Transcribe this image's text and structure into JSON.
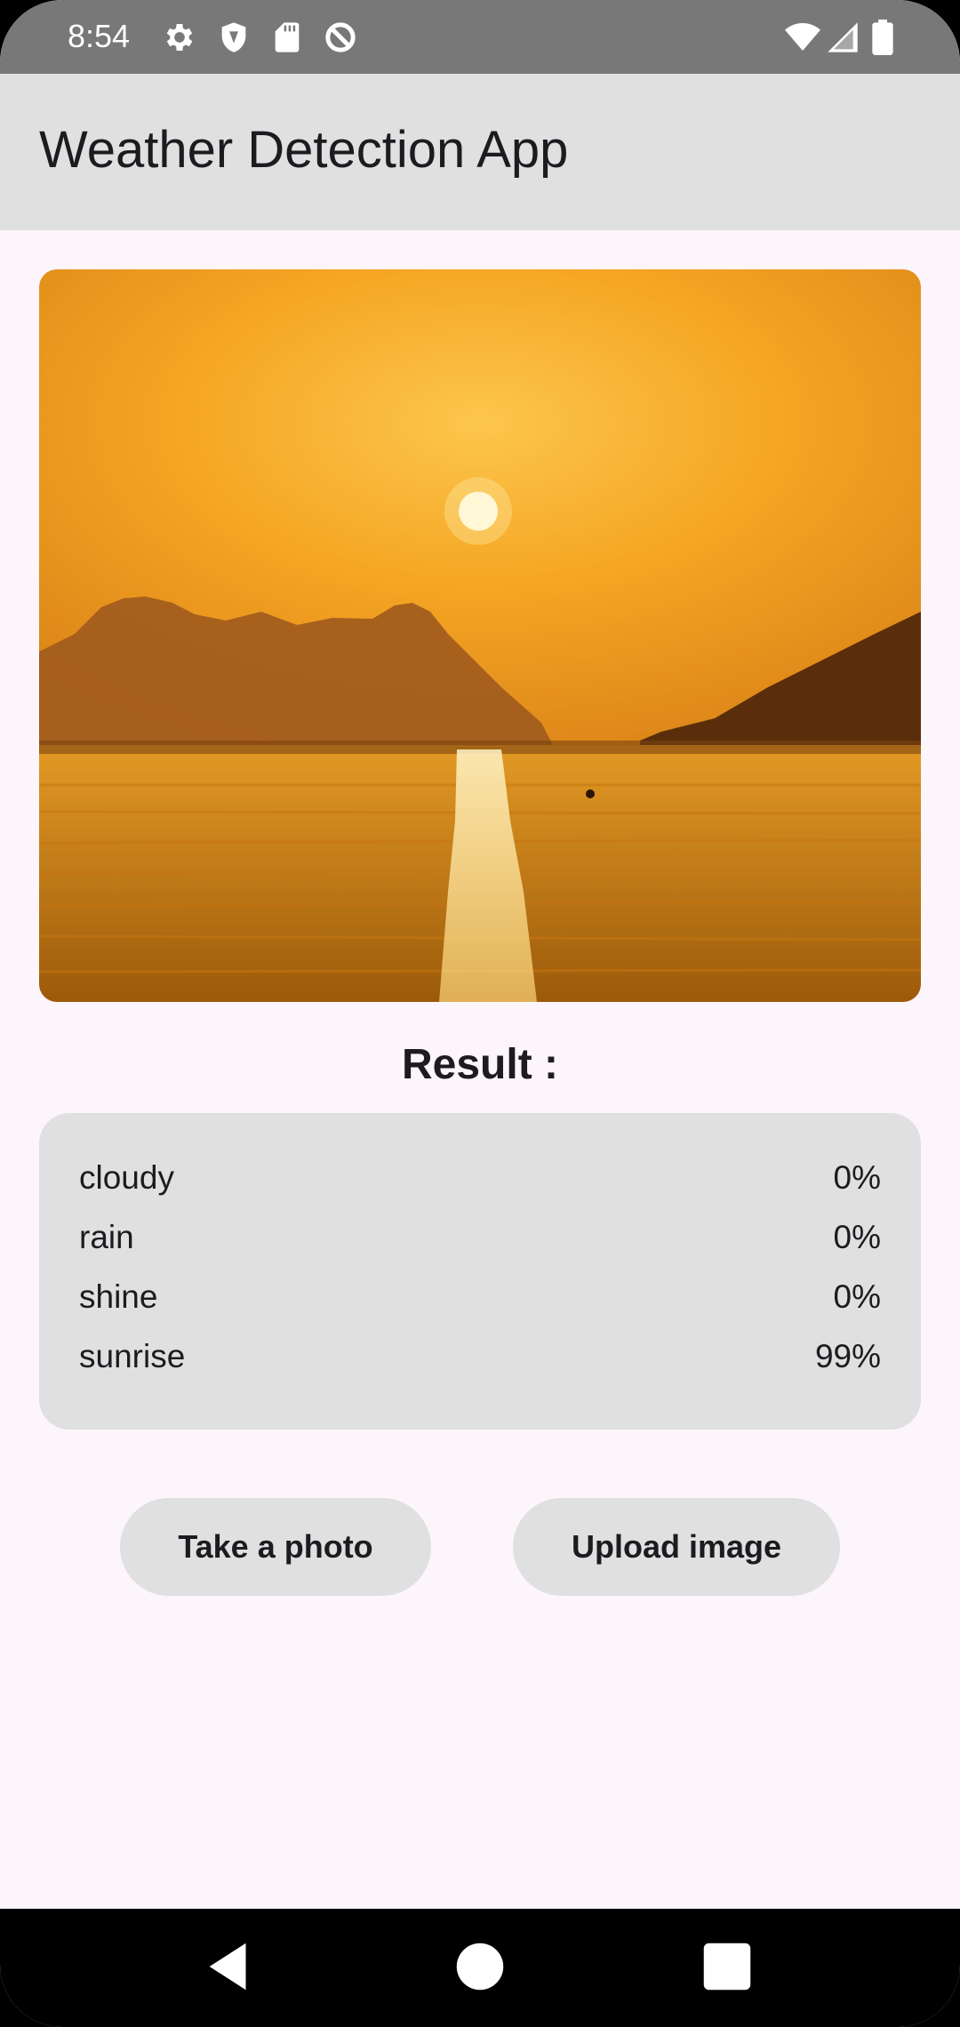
{
  "status_bar": {
    "time": "8:54",
    "left_icons": [
      "gear-icon",
      "shield-icon",
      "sd-card-icon",
      "data-saver-icon"
    ],
    "right_icons": [
      "wifi-icon",
      "cellular-signal-icon",
      "battery-icon"
    ]
  },
  "app_bar": {
    "title": "Weather Detection App"
  },
  "image": {
    "description_icon": "sunset-photo"
  },
  "result": {
    "heading": "Result :",
    "rows": [
      {
        "label": "cloudy",
        "value": "0%"
      },
      {
        "label": "rain",
        "value": "0%"
      },
      {
        "label": "shine",
        "value": "0%"
      },
      {
        "label": "sunrise",
        "value": "99%"
      }
    ]
  },
  "buttons": {
    "take_photo": "Take a photo",
    "upload_image": "Upload image"
  },
  "nav_bar": {
    "icons": [
      "back-icon",
      "home-icon",
      "recents-icon"
    ]
  },
  "colors": {
    "status_bar_bg": "#787878",
    "app_bar_bg": "#e0e0e0",
    "page_bg": "#fcf5fb",
    "card_bg": "#e0e0e0",
    "text": "#1d1b20"
  }
}
